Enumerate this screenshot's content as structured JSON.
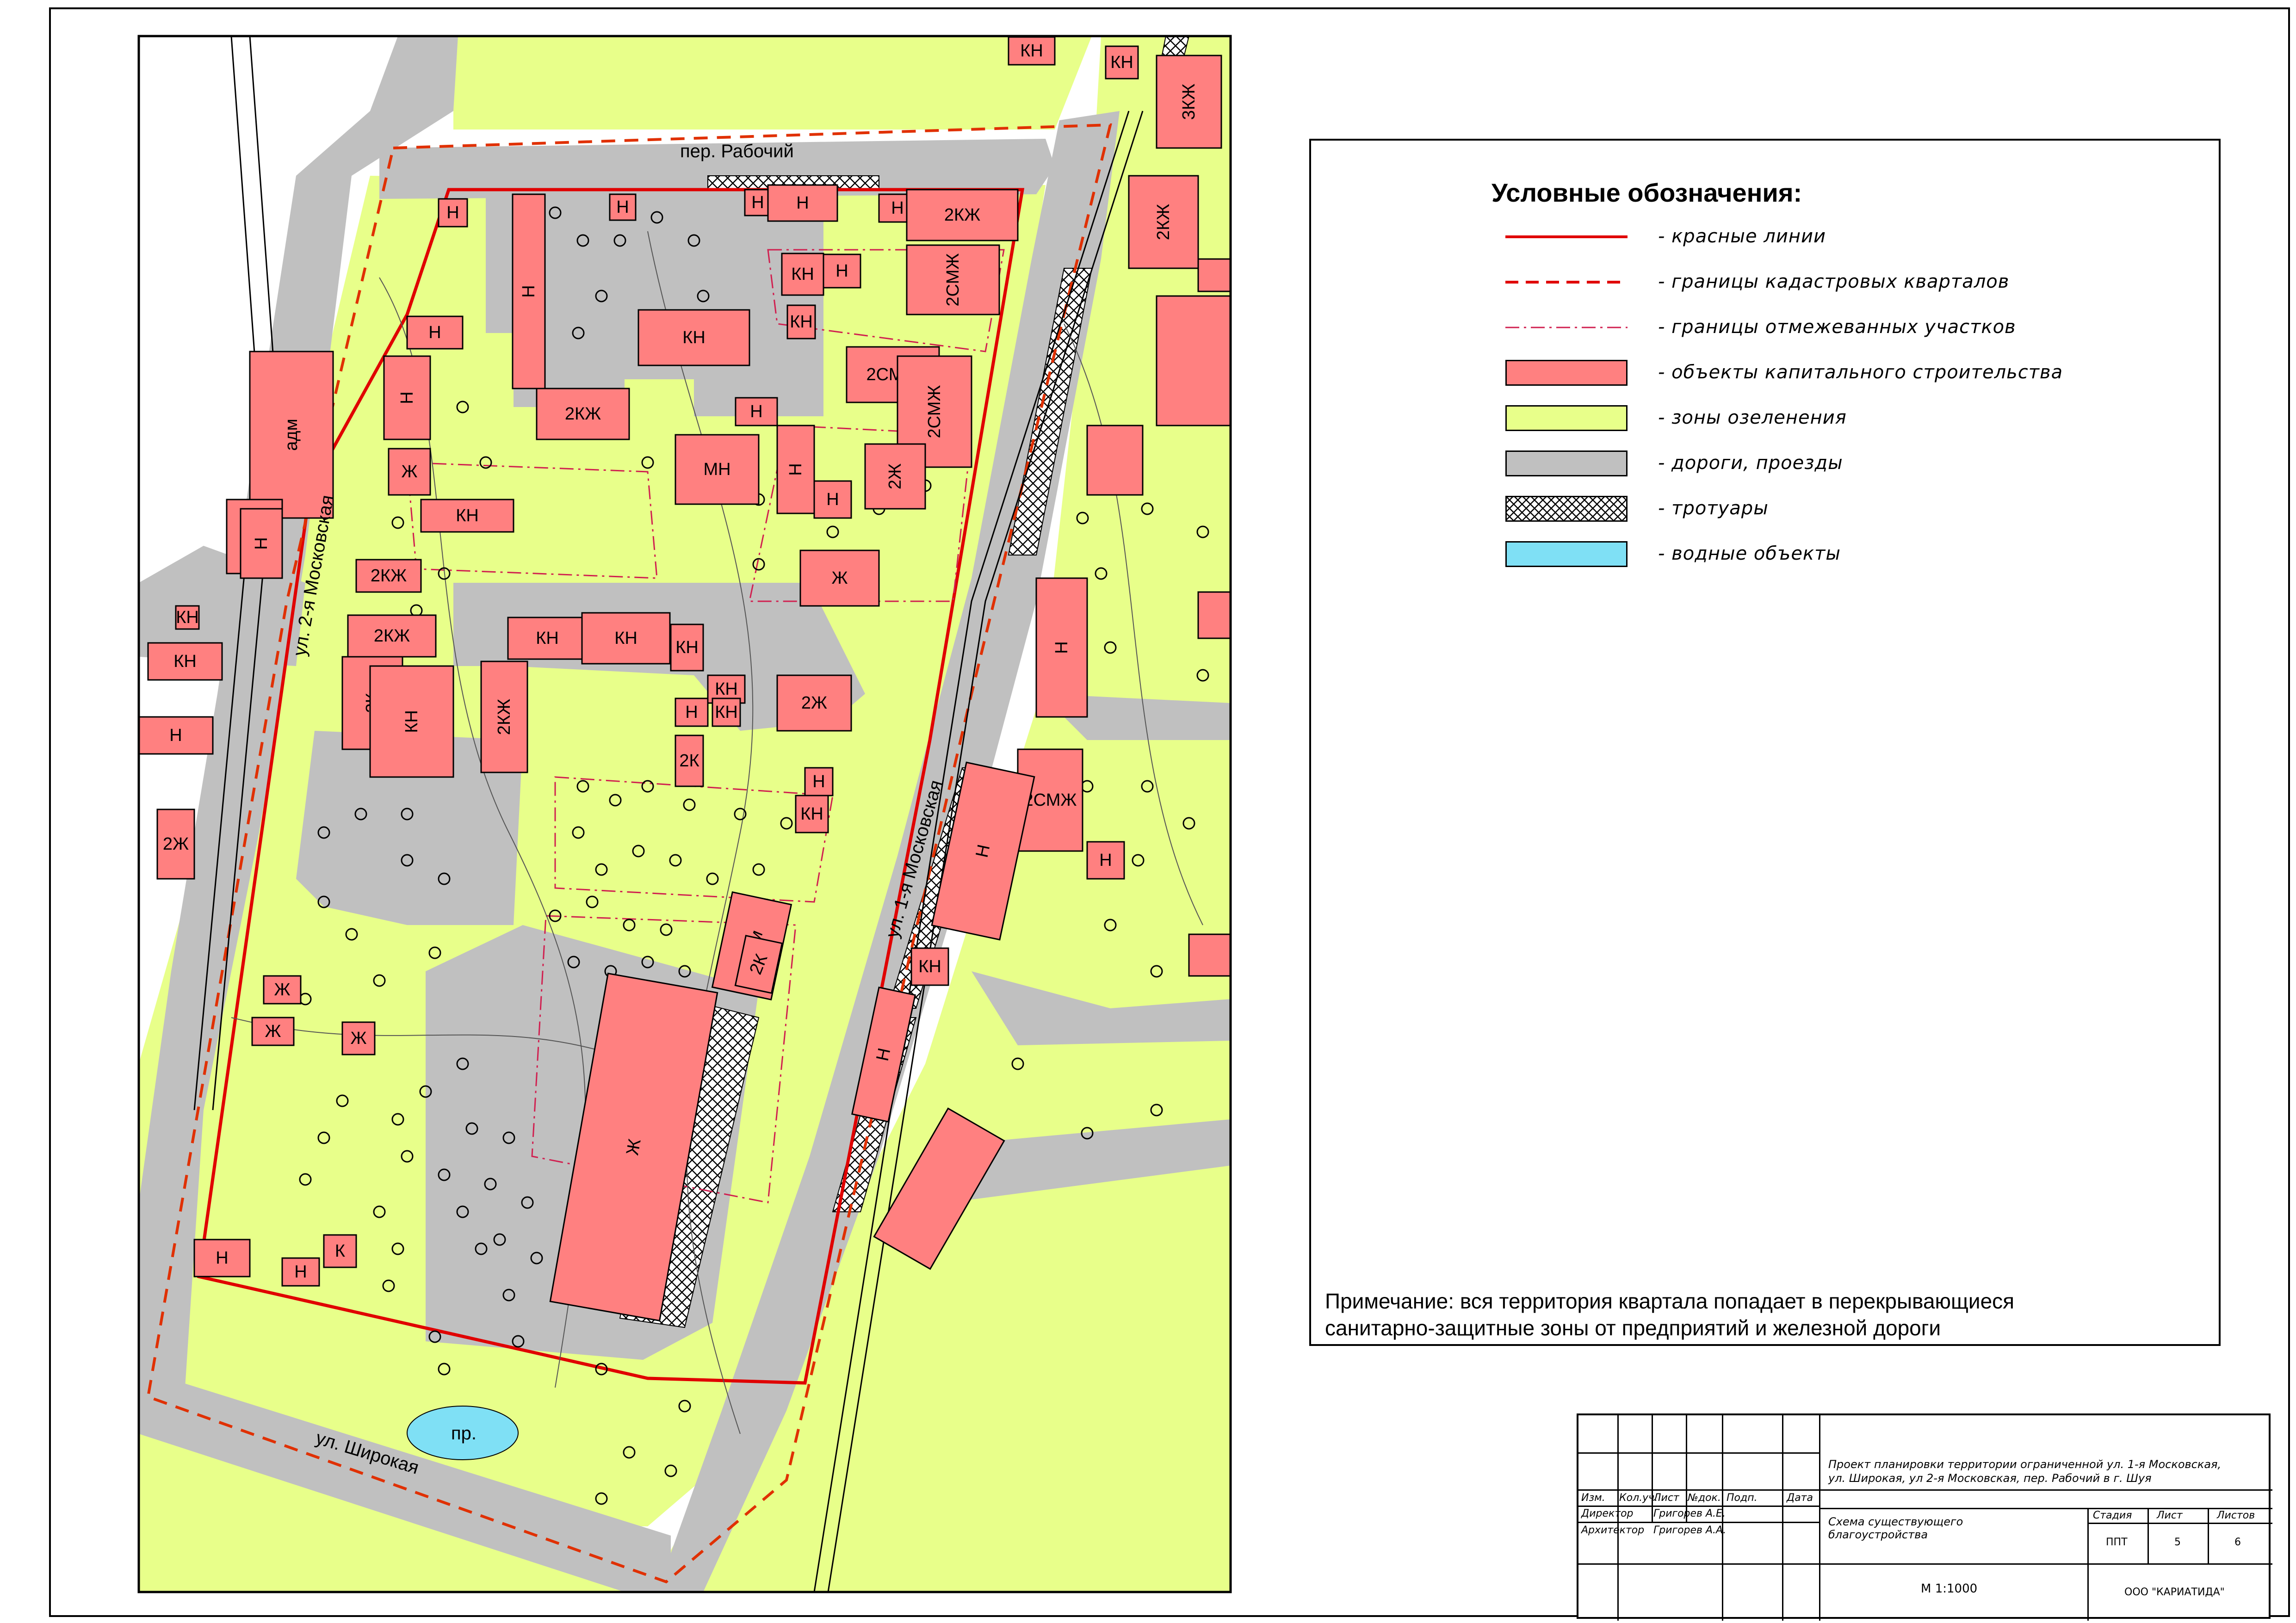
{
  "colors": {
    "green": "#e8ff8a",
    "road": "#c0c0c0",
    "building": "#ff8080",
    "red_line": "#e00000",
    "water": "#7fe0f5"
  },
  "legend": {
    "title": "Условные обозначения:",
    "items": [
      {
        "id": "red-lines",
        "label": "- красные линии",
        "kind": "line-solid"
      },
      {
        "id": "cadastral",
        "label": "- границы кадастровых кварталов",
        "kind": "line-dashed"
      },
      {
        "id": "plots",
        "label": "- границы отмежеванных участков",
        "kind": "line-dashdot"
      },
      {
        "id": "capital",
        "label": "- объекты капитального строительства",
        "kind": "fill-building"
      },
      {
        "id": "greening",
        "label": "- зоны озеленения",
        "kind": "fill-green"
      },
      {
        "id": "roads",
        "label": "- дороги, проезды",
        "kind": "fill-road"
      },
      {
        "id": "sidewalks",
        "label": "- тротуары",
        "kind": "fill-hatch"
      },
      {
        "id": "water",
        "label": "- водные объекты",
        "kind": "fill-water"
      }
    ]
  },
  "note": {
    "line1": "Примечание: вся территория квартала попадает в перекрывающиеся",
    "line2": "санитарно-защитные зоны от предприятий и железной дороги"
  },
  "streets": {
    "rabochiy": "пер. Рабочий",
    "moskovskaya2": "ул. 2-я Московская",
    "moskovskaya1": "ул. 1-я Московская",
    "shirokaya": "ул. Широкая",
    "pond": "пр."
  },
  "buildings": [
    {
      "label": "Н"
    },
    {
      "label": "Н"
    },
    {
      "label": "Н"
    },
    {
      "label": "Н"
    },
    {
      "label": "Н"
    },
    {
      "label": "2КЖ"
    },
    {
      "label": "КН"
    },
    {
      "label": "Н"
    },
    {
      "label": "2СМЖ"
    },
    {
      "label": "КН"
    },
    {
      "label": "КН"
    },
    {
      "label": "Н"
    },
    {
      "label": "2СМЖ"
    },
    {
      "label": "Н"
    },
    {
      "label": "2КЖ"
    },
    {
      "label": "Н"
    },
    {
      "label": "2СМЖ"
    },
    {
      "label": "Н"
    },
    {
      "label": "Ж"
    },
    {
      "label": "МН"
    },
    {
      "label": "Н"
    },
    {
      "label": "Н"
    },
    {
      "label": "2Ж"
    },
    {
      "label": "КН"
    },
    {
      "label": "Ж"
    },
    {
      "label": "2КЖ"
    },
    {
      "label": "2КЖ"
    },
    {
      "label": "КН"
    },
    {
      "label": "КН"
    },
    {
      "label": "КН"
    },
    {
      "label": "2К"
    },
    {
      "label": "КН"
    },
    {
      "label": "2КЖ"
    },
    {
      "label": "Н"
    },
    {
      "label": "КН"
    },
    {
      "label": "2Ж"
    },
    {
      "label": "КН"
    },
    {
      "label": "Н"
    },
    {
      "label": "КН"
    },
    {
      "label": "2К"
    },
    {
      "label": "адм"
    },
    {
      "label": "2К"
    },
    {
      "label": "Ж"
    },
    {
      "label": "Ж"
    },
    {
      "label": "Ж"
    },
    {
      "label": "Ж"
    },
    {
      "label": "Н"
    },
    {
      "label": "Н"
    },
    {
      "label": "К"
    },
    {
      "label": "адм"
    },
    {
      "label": "3К"
    },
    {
      "label": "Н"
    },
    {
      "label": "КН"
    },
    {
      "label": "КН"
    },
    {
      "label": "Н"
    },
    {
      "label": "2Ж"
    },
    {
      "label": "КН"
    },
    {
      "label": "КН"
    },
    {
      "label": "3КЖ"
    },
    {
      "label": "2КЖ"
    },
    {
      "label": "Н"
    },
    {
      "label": "2СМЖ"
    },
    {
      "label": "Н"
    },
    {
      "label": "Н"
    },
    {
      "label": "КН"
    },
    {
      "label": "Н"
    }
  ],
  "stamp": {
    "project": "Проект планировки территории ограниченной ул. 1-я Московская,",
    "project2": "ул. Широкая, ул 2-я Московская, пер. Рабочий в г. Шуя",
    "sheet_title": "Схема существующего",
    "sheet_title2": "благоустройства",
    "scale": "М 1:1000",
    "org": "ООО \"КАРИАТИДА\"",
    "cols": [
      "Изм.",
      "Кол.уч.",
      "Лист",
      "№док.",
      "Подп.",
      "Дата"
    ],
    "role1": "Директор",
    "person1": "Григорев А.Е.",
    "role2": "Архитектор",
    "person2": "Григорев А.А.",
    "h_stage": "Стадия",
    "h_sheet": "Лист",
    "h_sheets": "Листов",
    "stage": "ППТ",
    "sheet": "5",
    "sheets": "6"
  }
}
